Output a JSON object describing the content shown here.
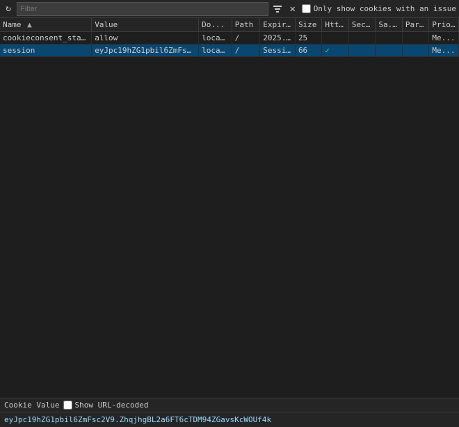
{
  "toolbar": {
    "filter_placeholder": "Filter",
    "only_show_issues_label": "Only show cookies with an issue"
  },
  "table": {
    "columns": [
      {
        "id": "name",
        "label": "Name",
        "sortable": true
      },
      {
        "id": "value",
        "label": "Value",
        "sortable": false
      },
      {
        "id": "domain",
        "label": "Do...",
        "sortable": false
      },
      {
        "id": "path",
        "label": "Path",
        "sortable": false
      },
      {
        "id": "expiry",
        "label": "Expir...",
        "sortable": false
      },
      {
        "id": "size",
        "label": "Size",
        "sortable": false
      },
      {
        "id": "http",
        "label": "Htt...",
        "sortable": false
      },
      {
        "id": "secure",
        "label": "Sec...",
        "sortable": false
      },
      {
        "id": "same",
        "label": "Sa...",
        "sortable": false
      },
      {
        "id": "part",
        "label": "Part...",
        "sortable": false
      },
      {
        "id": "prio",
        "label": "Prio...",
        "sortable": false
      }
    ],
    "rows": [
      {
        "name": "cookieconsent_status",
        "value": "allow",
        "domain": "loca...",
        "path": "/",
        "expiry": "2025...",
        "size": "25",
        "http": "",
        "secure": "",
        "same": "",
        "part": "",
        "prio": "Me...",
        "selected": false
      },
      {
        "name": "session",
        "value": "eyJpc19hZG1pbil6ZmFsc2V9.Zhq...",
        "domain": "loca...",
        "path": "/",
        "expiry": "Sessi...",
        "size": "66",
        "http": "✓",
        "secure": "",
        "same": "",
        "part": "",
        "prio": "Me...",
        "selected": true
      }
    ]
  },
  "footer": {
    "title": "Cookie Value",
    "show_url_decoded_label": "Show URL-decoded",
    "value": "eyJpc19hZG1pbil6ZmFsc2V9.ZhqjhgBL2a6FT6cTDM94ZGavsKcWOUf4k"
  }
}
